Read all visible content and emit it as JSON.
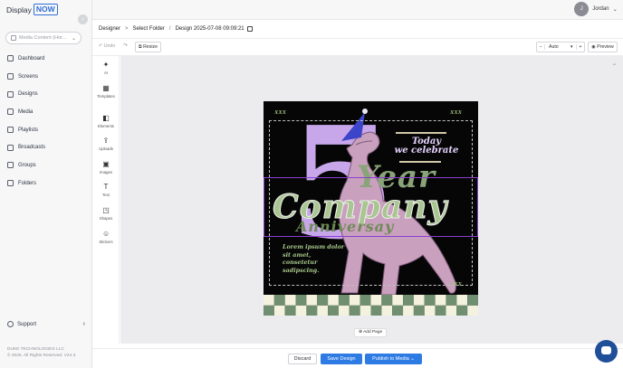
{
  "app": {
    "logo_text": "Display",
    "logo_badge": "NOW"
  },
  "sidebar": {
    "media_select_placeholder": "Media Content (Hor...",
    "items": [
      {
        "label": "Dashboard",
        "icon": "dashboard-icon"
      },
      {
        "label": "Screens",
        "icon": "screens-icon"
      },
      {
        "label": "Designs",
        "icon": "designs-icon"
      },
      {
        "label": "Media",
        "icon": "media-icon"
      },
      {
        "label": "Playlists",
        "icon": "playlists-icon"
      },
      {
        "label": "Broadcasts",
        "icon": "broadcasts-icon"
      },
      {
        "label": "Groups",
        "icon": "groups-icon"
      },
      {
        "label": "Folders",
        "icon": "folders-icon"
      }
    ],
    "support_label": "Support",
    "company_line1": "DUKE TECHNOLOGIES LLC",
    "company_line2": "© 2025. All Rights Reserved. V24.3"
  },
  "user": {
    "initial": "J",
    "name": "Jordan"
  },
  "breadcrumb": {
    "root": "Designer",
    "folder": "Select Folder",
    "design": "Design 2025-07-08 09:09:21"
  },
  "toolbar": {
    "undo_label": "Undo",
    "redo_glyph": "↷",
    "resize_label": "Resize",
    "zoom_minus": "−",
    "zoom_value": "Auto",
    "zoom_plus": "+",
    "preview_label": "Preview"
  },
  "tools": [
    {
      "label": "AI",
      "icon": "sparkle-icon",
      "glyph": "✦"
    },
    {
      "label": "Templates",
      "icon": "templates-icon",
      "glyph": "▦"
    },
    {
      "label": "Elements",
      "icon": "elements-icon",
      "glyph": "◧"
    },
    {
      "label": "Uploads",
      "icon": "upload-icon",
      "glyph": "⇪"
    },
    {
      "label": "Images",
      "icon": "image-icon",
      "glyph": "▣"
    },
    {
      "label": "Text",
      "icon": "text-icon",
      "glyph": "T"
    },
    {
      "label": "Shapes",
      "icon": "shapes-icon",
      "glyph": "◳"
    },
    {
      "label": "Stickers",
      "icon": "sticker-icon",
      "glyph": "☺"
    }
  ],
  "canvas": {
    "more_glyph": "···",
    "add_page_label": "Add Page"
  },
  "design": {
    "xxx_label": "XXX",
    "number": "5",
    "today_line1": "Today",
    "today_line2": "we celebrate",
    "year_text": "Year",
    "company_text": "Company",
    "anniversary_text": "Anniversay",
    "lorem_text": "Lorem ipsum dolor sit amet, consetetur sadipscing.",
    "colors": {
      "background": "#060606",
      "lavender": "#c7a6ea",
      "sage": "#a9c590",
      "olive": "#6e8a55"
    }
  },
  "footer": {
    "discard_label": "Discard",
    "save_label": "Save Design",
    "publish_label": "Publish to Media"
  },
  "colors": {
    "accent": "#2f7be4",
    "selection": "#8a3fd1"
  }
}
